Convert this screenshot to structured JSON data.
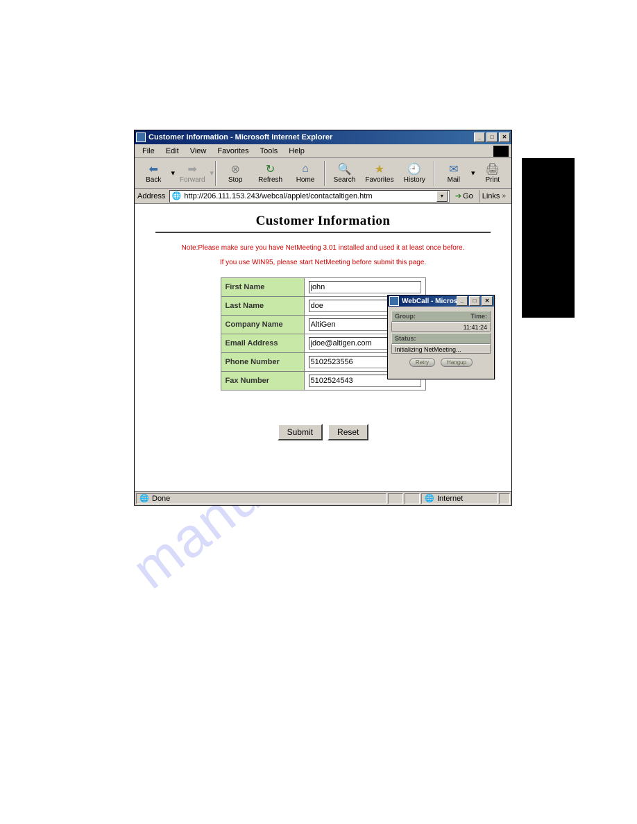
{
  "window": {
    "title": "Customer Information - Microsoft Internet Explorer"
  },
  "menubar": {
    "items": [
      "File",
      "Edit",
      "View",
      "Favorites",
      "Tools",
      "Help"
    ]
  },
  "toolbar": {
    "back": "Back",
    "forward": "Forward",
    "stop": "Stop",
    "refresh": "Refresh",
    "home": "Home",
    "search": "Search",
    "favorites": "Favorites",
    "history": "History",
    "mail": "Mail",
    "print": "Print"
  },
  "addressbar": {
    "label": "Address",
    "value": "http://206.111.153.243/webcal/applet/contactaltigen.htm",
    "go": "Go",
    "links": "Links"
  },
  "content": {
    "heading": "Customer Information",
    "note1": "Note:Please make sure you have NetMeeting 3.01 installed and used it at least once before.",
    "note2": "If you use WIN95, please start NetMeeting before submit this page.",
    "fields": [
      {
        "label": "First Name",
        "value": "john"
      },
      {
        "label": "Last Name",
        "value": "doe"
      },
      {
        "label": "Company Name",
        "value": "AltiGen"
      },
      {
        "label": "Email Address",
        "value": "jdoe@altigen.com"
      },
      {
        "label": "Phone Number",
        "value": "5102523556"
      },
      {
        "label": "Fax Number",
        "value": "5102524543"
      }
    ],
    "submit": "Submit",
    "reset": "Reset"
  },
  "statusbar": {
    "status": "Done",
    "zone": "Internet"
  },
  "popup": {
    "title": "WebCall - Microsoft I...",
    "group_label": "Group:",
    "time_label": "Time:",
    "time_value": "11:41:24",
    "status_label": "Status:",
    "status_value": "Initializing NetMeeting...",
    "retry": "Retry",
    "hangup": "Hangup"
  },
  "watermark": "manualshive.com"
}
